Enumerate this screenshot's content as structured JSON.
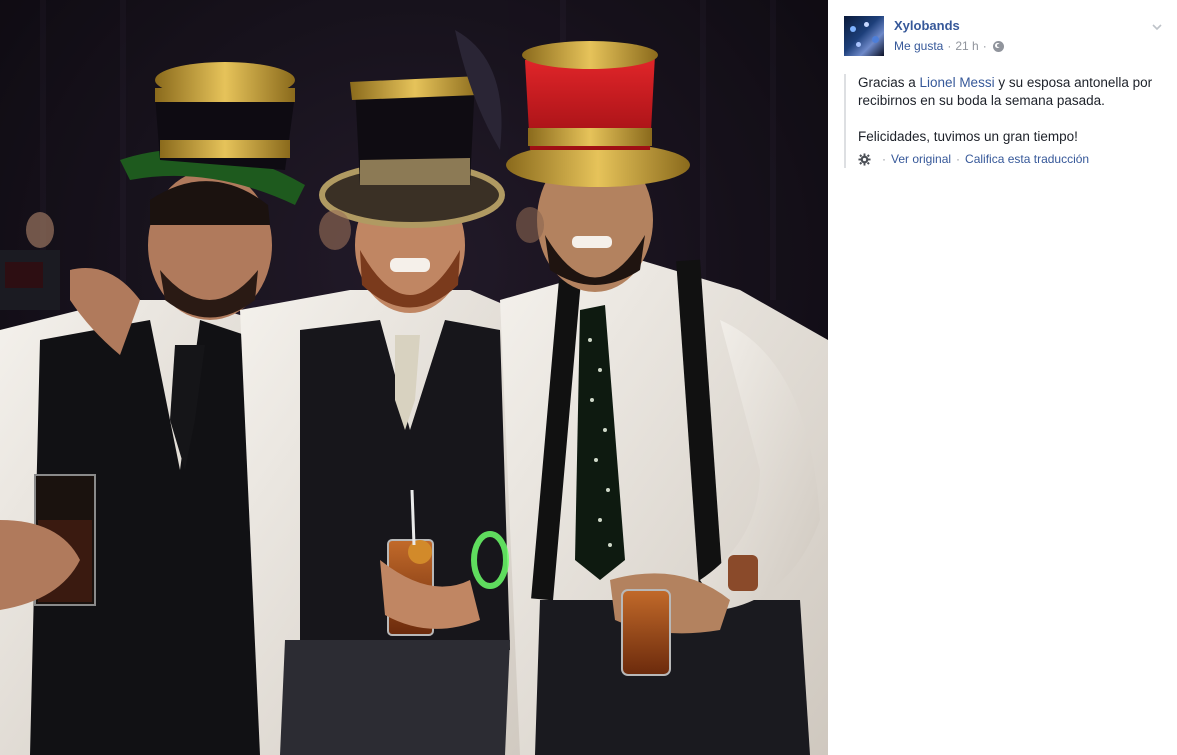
{
  "post": {
    "page_name": "Xylobands",
    "like_label": "Me gusta",
    "separator": "·",
    "timestamp": "21 h",
    "privacy_icon": "globe-icon",
    "menu_icon": "chevron-down-icon",
    "text_before_mention": "Gracias a ",
    "mention": "Lionel Messi",
    "text_after_mention": " y su esposa antonella por recibirnos en su boda la semana pasada.",
    "second_paragraph": "Felicidades, tuvimos un gran tiempo!",
    "translation": {
      "settings_icon": "gear-icon",
      "see_original": "Ver original",
      "rate_translation": "Califica esta traducción"
    }
  },
  "photo": {
    "subject": "three men in vests and decorated top hats at a party"
  },
  "colors": {
    "link": "#365899",
    "meta": "#90949c",
    "photo_bg": "#0c0a10"
  }
}
